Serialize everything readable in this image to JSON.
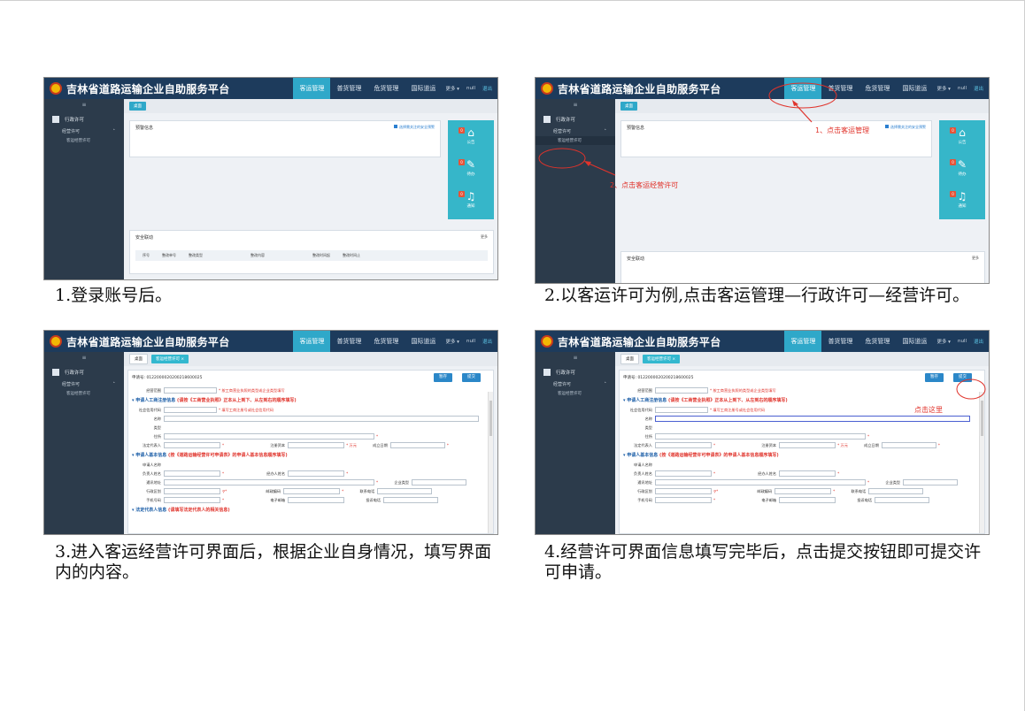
{
  "app": {
    "brand": "吉林省道路运输企业自助服务平台",
    "nav": [
      "客运管理",
      "普货管理",
      "危货管理",
      "国际道运"
    ],
    "more": "更多 ▾",
    "user": "null",
    "logout": "退出"
  },
  "sidebar": {
    "collapse": "≡",
    "admin_permit": "行政许可",
    "business_permit": "经营许可",
    "passenger_permit": "客运经营许可"
  },
  "tabs": {
    "desktop": "桌面",
    "passenger": "客运经营许可 ×"
  },
  "dashboard": {
    "warning_title": "预警信息",
    "warning_link": "选择需关注的安全预警",
    "safety_title": "安全联动",
    "safety_more": "更多",
    "table_headers": [
      "序号",
      "整改单号",
      "整改类型",
      "整改内容",
      "整改时间起",
      "整改时间止"
    ],
    "quick": [
      {
        "label": "公告",
        "badge": "0",
        "icon": "⌂"
      },
      {
        "label": "待办",
        "badge": "0",
        "icon": "✎"
      },
      {
        "label": "通知",
        "badge": "0",
        "icon": "♫"
      }
    ]
  },
  "form": {
    "app_no": "申请号: 0122000020200218600025",
    "save": "暂存",
    "submit": "提交",
    "field_scope": "经营范围",
    "scope_hint": "* 按工商营业执照的类型或企业类型填写",
    "sec_business": "申请人工商注册信息",
    "sec_business_note": "(请按《工商营业执照》正本从上到下、从左到右的顺序填写)",
    "f_credit": "社会信用代码",
    "credit_hint": "* 填写工商注册号或社会信用代码",
    "f_name": "名称",
    "f_type": "类型",
    "f_addr": "住所",
    "f_legal": "法定代表人",
    "f_capital": "注册资本",
    "capital_unit": "* 万元",
    "f_date": "成立日期",
    "sec_basic": "申请人基本信息",
    "sec_basic_note": "(按《道路运输经营许可申请表》的申请人基本信息顺序填写)",
    "f_applicant": "申请人名称",
    "f_owner": "负责人姓名",
    "f_agent": "经办人姓名",
    "f_mail_addr": "通讯地址",
    "f_ent_type": "企业类型",
    "f_region": "行政区划",
    "f_zip": "邮政编码",
    "f_phone": "联系电话",
    "f_mobile": "手机号码",
    "f_email": "电子邮箱",
    "f_complaint": "投诉电话",
    "sec_more": "法定代表人信息",
    "sec_more_note": "(请填写法定代表人的相关信息)"
  },
  "annotations": {
    "step1": "1、点击客运管理",
    "step2": "2、点击客运经营许可",
    "click_here": "点击这里"
  },
  "captions": {
    "c1": "1.登录账号后。",
    "c2": "2.以客运许可为例,点击客运管理—行政许可—经营许可。",
    "c3": "3.进入客运经营许可界面后，根据企业自身情况，填写界面内的内容。",
    "c4": "4.经营许可界面信息填写完毕后，点击提交按钮即可提交许可申请。"
  },
  "colors": {
    "topbar": "#1d3b5c",
    "accent": "#2fa8c9",
    "sidebar": "#2c3b4b",
    "annotation": "#e0332b"
  }
}
